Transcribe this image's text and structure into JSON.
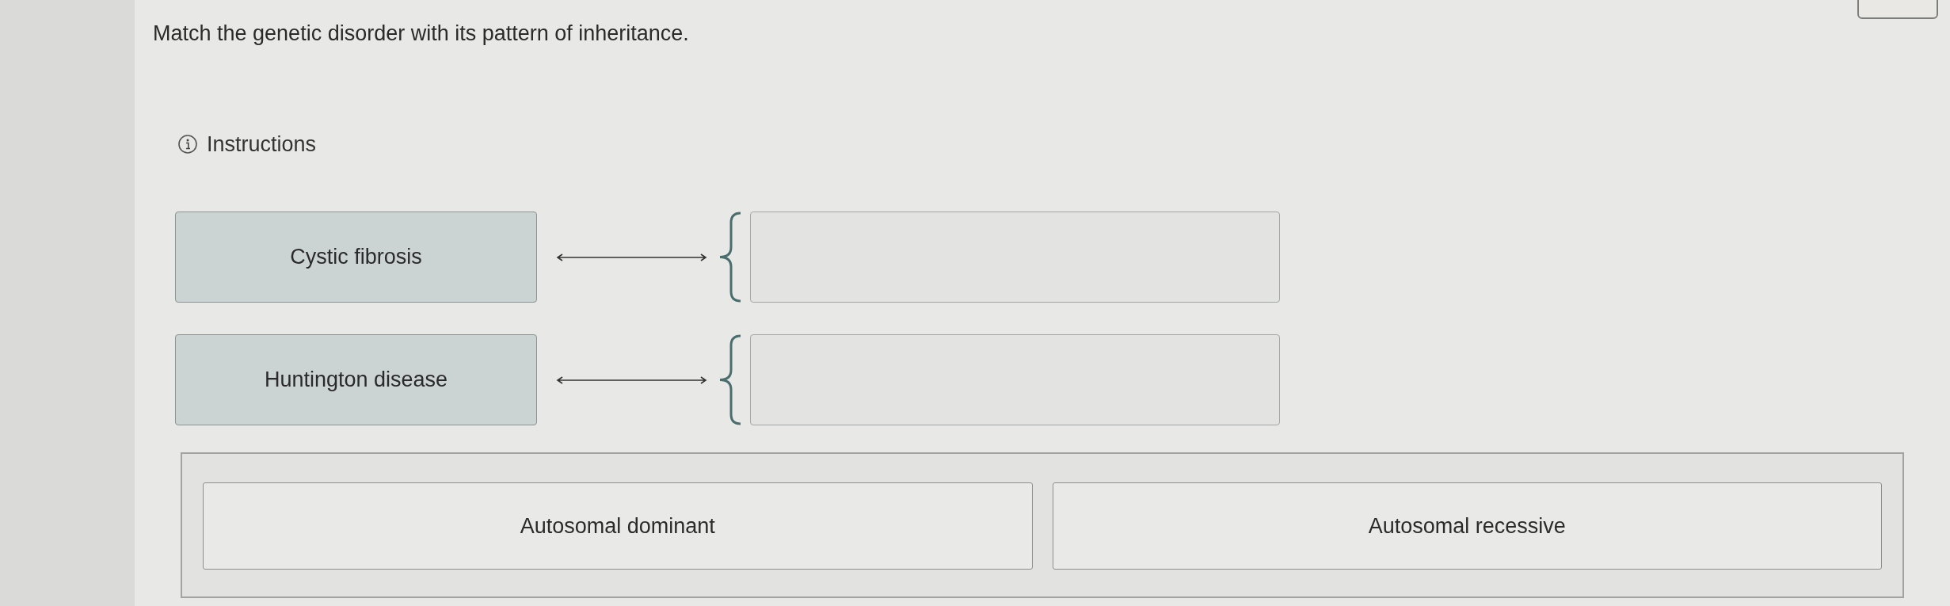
{
  "question": "Match the genetic disorder with its pattern of inheritance.",
  "instructions": {
    "label": "Instructions"
  },
  "pairs": [
    {
      "prompt": "Cystic fibrosis"
    },
    {
      "prompt": "Huntington disease"
    }
  ],
  "answer_bank": [
    {
      "label": "Autosomal dominant"
    },
    {
      "label": "Autosomal recessive"
    }
  ]
}
